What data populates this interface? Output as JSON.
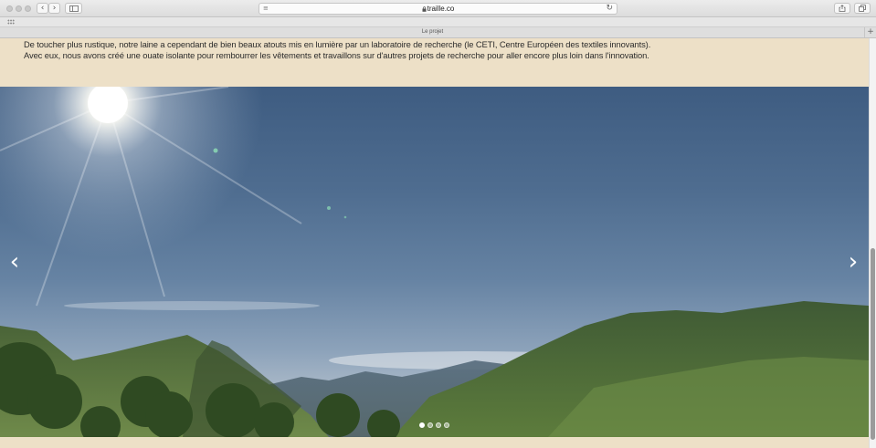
{
  "browser": {
    "url": "traille.co",
    "tab_title": "Le projet",
    "lock_icon": "lock-icon",
    "icons": {
      "back": "‹",
      "forward": "›",
      "sidebar": "sidebar-icon",
      "reader": "≡",
      "reload": "↻",
      "share": "share-icon",
      "tabs": "tabs-icon",
      "new_tab": "+"
    }
  },
  "content": {
    "line1": "De toucher plus rustique, notre laine a cependant de bien beaux atouts mis en lumière par un laboratoire de recherche (le CETI, Centre Européen des textiles innovants).",
    "line2": "Avec eux, nous avons créé une ouate isolante pour rembourrer les vêtements et travaillons sur d'autres projets de recherche pour aller encore plus loin dans l'innovation."
  },
  "slider": {
    "prev": "‹",
    "next": "›",
    "slides": 4,
    "active_slide": 1
  },
  "colors": {
    "page_background": "#ede0c7",
    "text": "#2c2c2c"
  }
}
